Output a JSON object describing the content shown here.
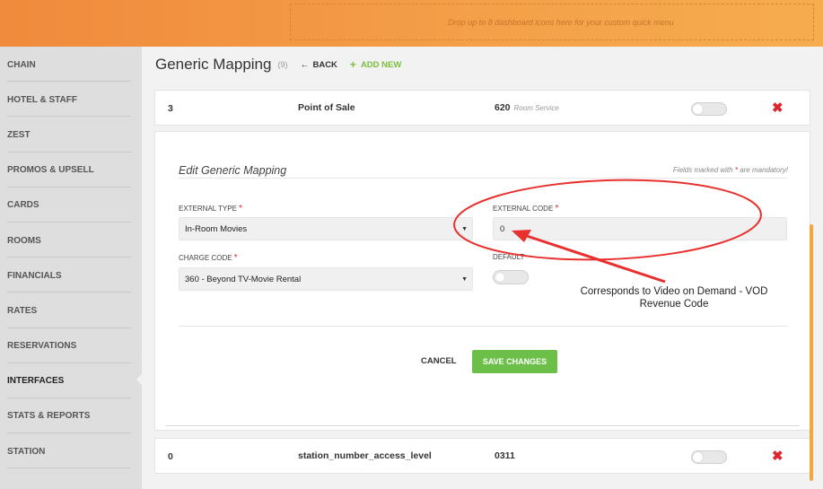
{
  "topbar": {
    "dropzone_text": "Drop up to 8 dashboard icons here for your custom quick menu"
  },
  "sidebar": {
    "items": [
      {
        "label": "CHAIN"
      },
      {
        "label": "HOTEL & STAFF"
      },
      {
        "label": "ZEST"
      },
      {
        "label": "PROMOS & UPSELL"
      },
      {
        "label": "CARDS"
      },
      {
        "label": "ROOMS"
      },
      {
        "label": "FINANCIALS"
      },
      {
        "label": "RATES"
      },
      {
        "label": "RESERVATIONS"
      },
      {
        "label": "INTERFACES"
      },
      {
        "label": "STATS & REPORTS"
      },
      {
        "label": "STATION"
      }
    ],
    "active": "INTERFACES"
  },
  "header": {
    "title": "Generic Mapping",
    "count": "(9)",
    "back_label": "BACK",
    "add_label": "ADD NEW"
  },
  "rows": [
    {
      "id": "3",
      "name": "Point of Sale",
      "code": "620",
      "code_desc": "Room Service"
    },
    {
      "id": "0",
      "name": "station_number_access_level",
      "code": "0311",
      "code_desc": ""
    }
  ],
  "edit_form": {
    "title": "Edit Generic Mapping",
    "mandatory_prefix": "Fields marked with",
    "mandatory_star": "*",
    "mandatory_suffix": "are mandatory!",
    "external_type": {
      "label": "EXTERNAL TYPE",
      "star": "*",
      "value": "In-Room Movies"
    },
    "external_code": {
      "label": "EXTERNAL CODE",
      "star": "*",
      "value": "0"
    },
    "charge_code": {
      "label": "CHARGE CODE",
      "star": "*",
      "value": "360 - Beyond TV-Movie Rental"
    },
    "default": {
      "label": "DEFAULT"
    },
    "cancel_label": "CANCEL",
    "save_label": "SAVE CHANGES"
  },
  "annotation": {
    "line1": "Corresponds to Video on Demand - VOD",
    "line2": "Revenue Code",
    "color": "#e8302e"
  },
  "colors": {
    "accent_orange": "#f4a04a",
    "add_green": "#7bbf3c",
    "save_green": "#6cc04a",
    "delete_red": "#d9262f"
  }
}
